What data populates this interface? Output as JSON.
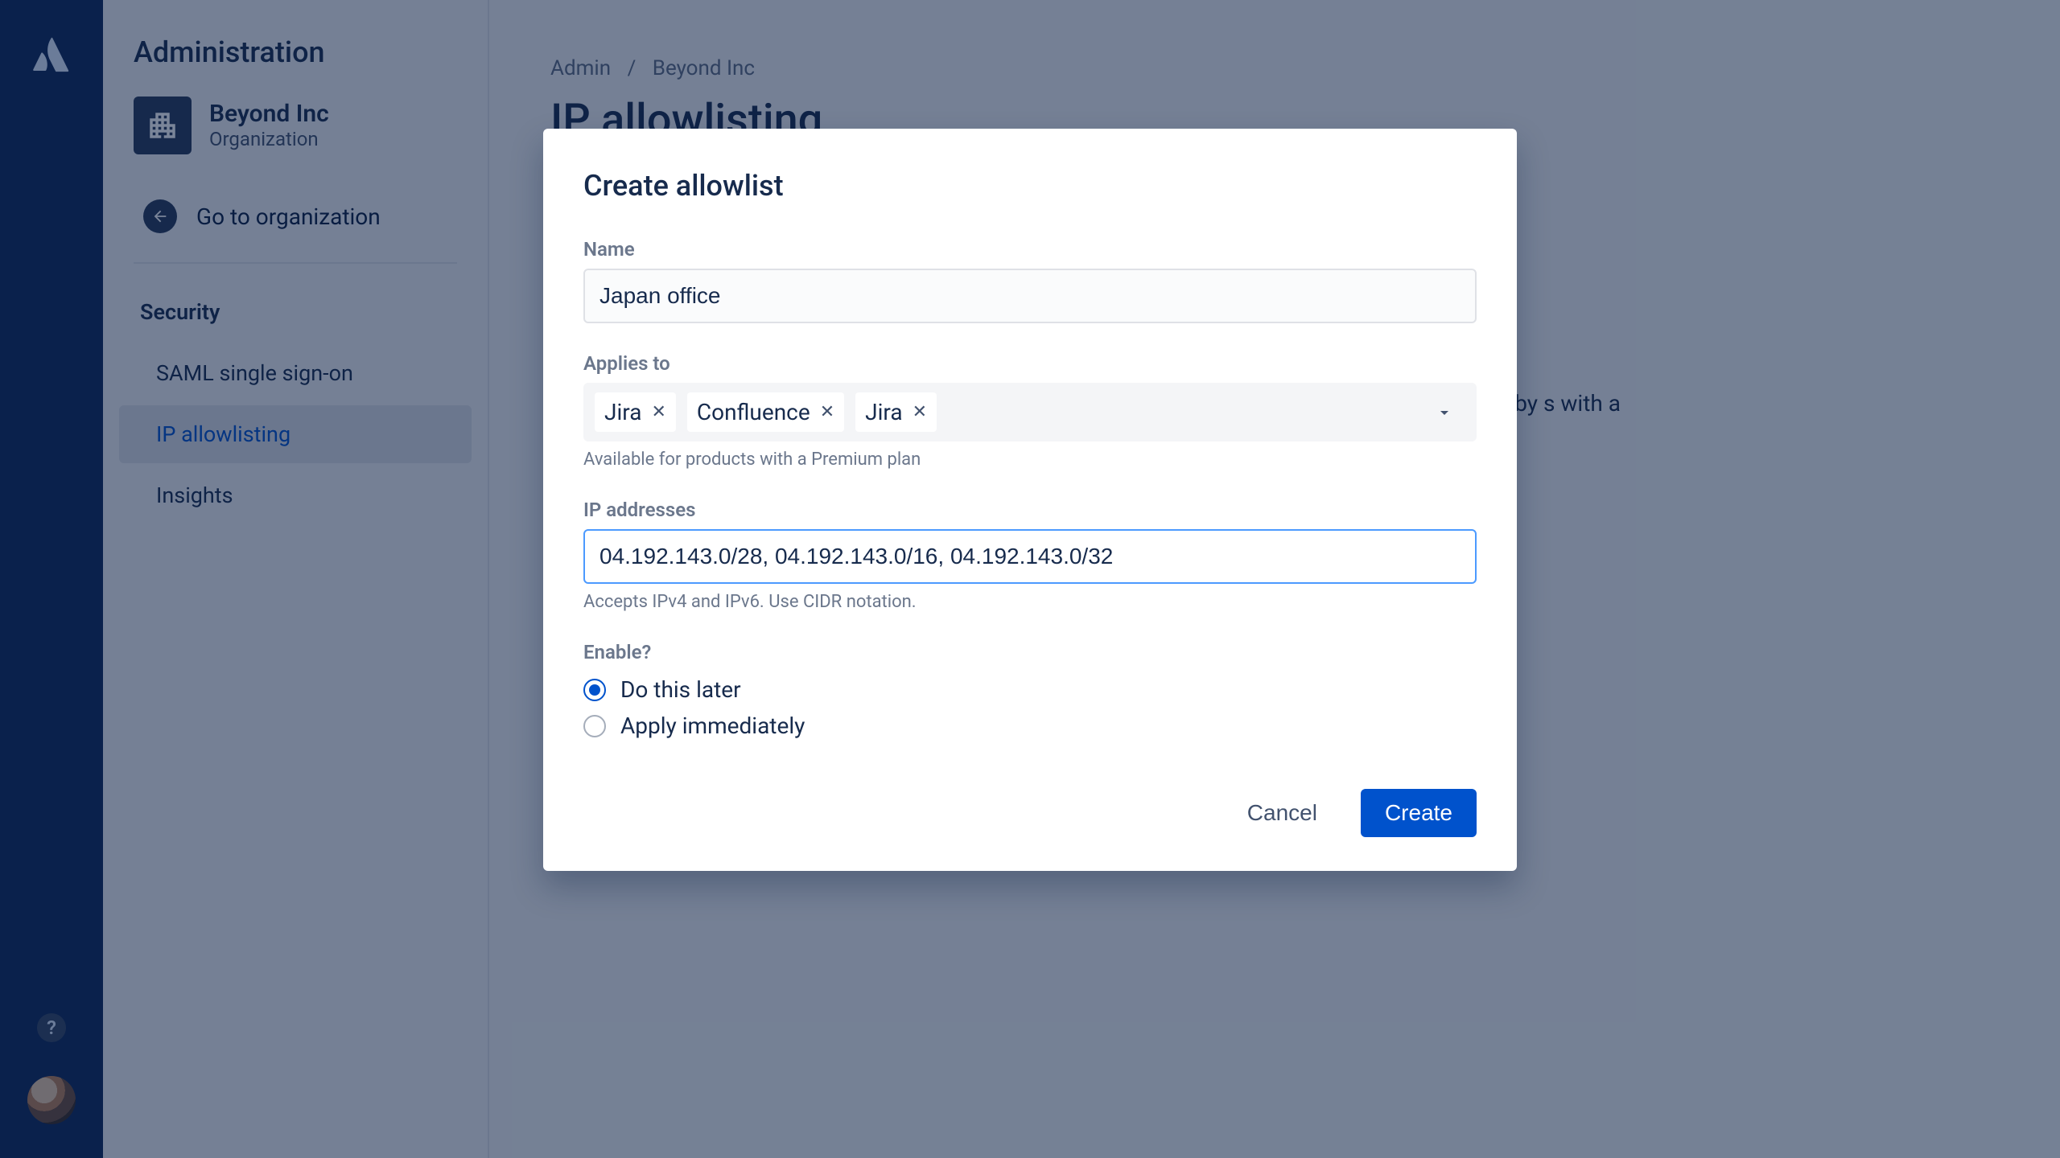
{
  "sidebar": {
    "title": "Administration",
    "org": {
      "name": "Beyond Inc",
      "subtitle": "Organization"
    },
    "goBack": "Go to organization",
    "sectionHeader": "Security",
    "items": [
      {
        "label": "SAML single sign-on"
      },
      {
        "label": "IP allowlisting"
      },
      {
        "label": "Insights"
      }
    ]
  },
  "breadcrumb": {
    "a": "Admin",
    "sep": "/",
    "b": "Beyond Inc"
  },
  "pageTitle": "IP allowlisting",
  "pageDesc": "sses by s with a",
  "modal": {
    "title": "Create allowlist",
    "name": {
      "label": "Name",
      "value": "Japan office"
    },
    "appliesTo": {
      "label": "Applies to",
      "helper": "Available for products with a Premium plan",
      "tags": [
        "Jira",
        "Confluence",
        "Jira"
      ]
    },
    "ip": {
      "label": "IP addresses",
      "value": "04.192.143.0/28, 04.192.143.0/16, 04.192.143.0/32",
      "helper": "Accepts IPv4 and IPv6. Use CIDR notation."
    },
    "enable": {
      "label": "Enable?",
      "options": [
        {
          "label": "Do this later",
          "checked": true
        },
        {
          "label": "Apply immediately",
          "checked": false
        }
      ]
    },
    "actions": {
      "cancel": "Cancel",
      "create": "Create"
    }
  }
}
